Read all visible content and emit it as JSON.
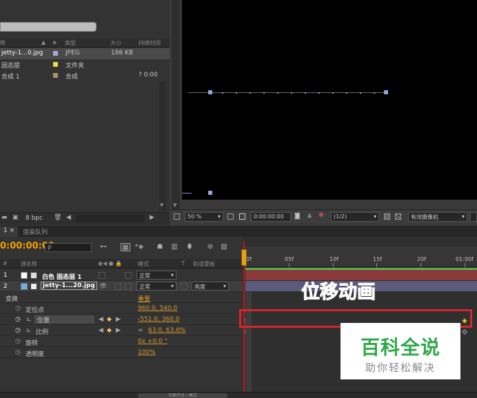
{
  "project": {
    "columns": {
      "name": "称",
      "type": "类型",
      "size": "大小",
      "duration": "持续时间"
    },
    "items": [
      {
        "name": "jetty-1...0.jpg",
        "type": "JPEG",
        "size": "186 KB",
        "duration": "",
        "color": "#a8a8d8"
      },
      {
        "name": "固态层",
        "type": "文件夹",
        "size": "",
        "duration": "",
        "color": "#e8d84a"
      },
      {
        "name": "合成 1",
        "type": "合成",
        "size": "",
        "duration": "? 0:00",
        "color": "#a8966a"
      }
    ],
    "bpc": "8 bpc"
  },
  "viewer": {
    "zoom": "50 %",
    "timecode": "0:00:00:00",
    "resolution": "(1/2)",
    "camera": "有效摄像机"
  },
  "timeline": {
    "tabs": [
      "1 ×",
      "渲染队列"
    ],
    "timecode": "0:00:00:00",
    "search_placeholder": "ρ",
    "header": {
      "num": "#",
      "source": "源名称",
      "mode": "模式",
      "t": "T",
      "trkmat": "轨道蒙板"
    },
    "layers": [
      {
        "num": "1",
        "name": "白色 固态层 1",
        "mode": "正常"
      },
      {
        "num": "2",
        "name": "jetty-1...20.jpg",
        "mode": "正常",
        "trkmat": "亮度"
      }
    ],
    "transform": {
      "label": "变换",
      "reset": "重置"
    },
    "properties": [
      {
        "name": "定位点",
        "value": "960.0, 540.0"
      },
      {
        "name": "位置",
        "value": "-551.0, 360.0"
      },
      {
        "name": "比例",
        "value": "63.0, 63.0%"
      },
      {
        "name": "旋转",
        "value": "0x +0.0 °"
      },
      {
        "name": "透明度",
        "value": "100%"
      }
    ],
    "ruler": [
      "0f",
      "05f",
      "10f",
      "15f",
      "20f",
      "01:00f"
    ],
    "bottom_label": "切换开关 / 模式"
  },
  "annotation": {
    "text": "位移动画"
  },
  "watermark": {
    "title": "百科全说",
    "subtitle": "助你轻松解决"
  },
  "colors": {
    "accent": "#f0a000",
    "annotation": "#d8252b",
    "workarea": "#5cae4c",
    "logo_green": "#2fa84a"
  }
}
